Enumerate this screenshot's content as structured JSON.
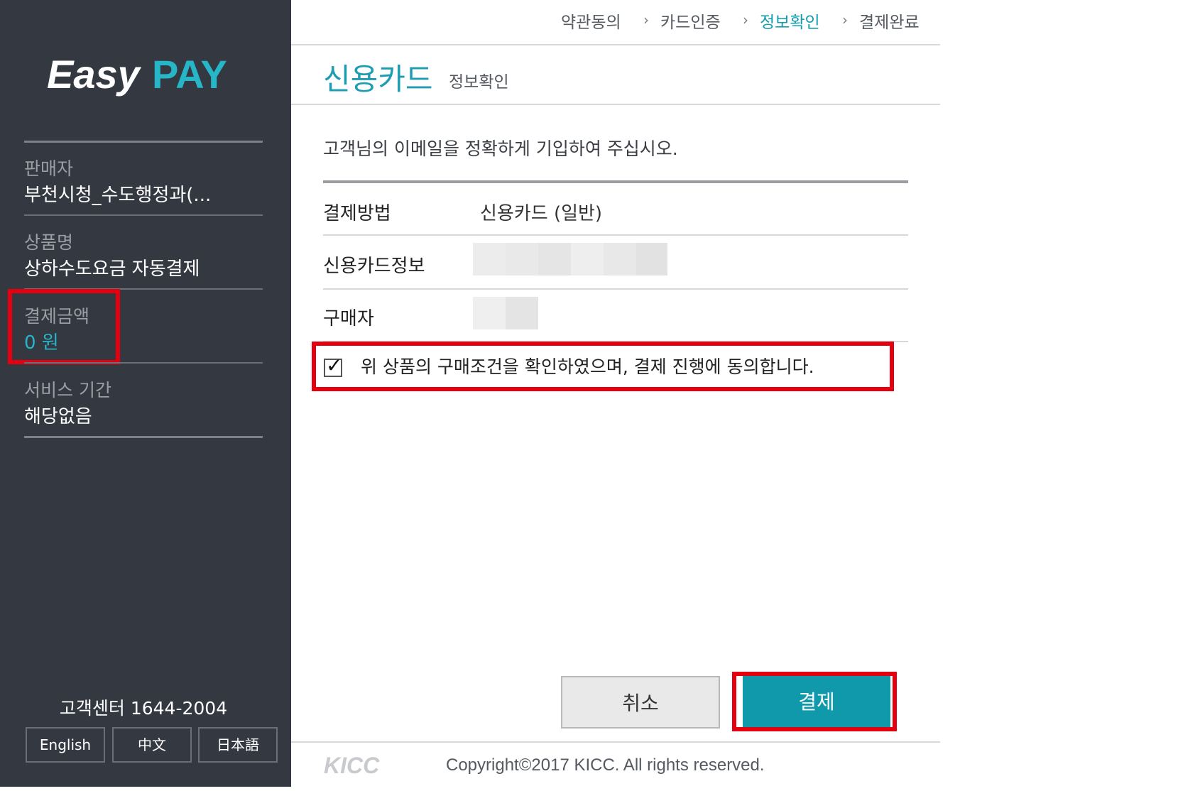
{
  "brand": {
    "logo_easy": "Easy",
    "logo_pay": "PAY"
  },
  "sidebar": {
    "seller_label": "판매자",
    "seller_value": "부천시청_수도행정과(...",
    "product_label": "상품명",
    "product_value": "상하수도요금 자동결제",
    "amount_label": "결제금액",
    "amount_value": "0 원",
    "period_label": "서비스 기간",
    "period_value": "해당없음",
    "customer_center": "고객센터 1644-2004",
    "languages": [
      "English",
      "中文",
      "日本語"
    ]
  },
  "steps": [
    {
      "label": "약관동의",
      "active": false
    },
    {
      "label": "카드인증",
      "active": false
    },
    {
      "label": "정보확인",
      "active": true
    },
    {
      "label": "결제완료",
      "active": false
    }
  ],
  "main": {
    "title": "신용카드",
    "subtitle": "정보확인",
    "instruction": "고객님의 이메일을 정확하게 기입하여 주십시오.",
    "payment_method_label": "결제방법",
    "payment_method_value": "신용카드 (일반)",
    "card_info_label": "신용카드정보",
    "buyer_label": "구매자",
    "agree_text": "위 상품의 구매조건을 확인하였으며, 결제 진행에 동의합니다.",
    "agree_checked": true,
    "cancel_label": "취소",
    "pay_label": "결제"
  },
  "footer": {
    "kicc_logo": "KICC",
    "copyright": "Copyright©2017 KICC. All rights reserved."
  },
  "colors": {
    "sidebar_bg": "#343841",
    "accent": "#1e9db2",
    "pay_button": "#1098ab",
    "highlight_red": "#e4000f"
  }
}
